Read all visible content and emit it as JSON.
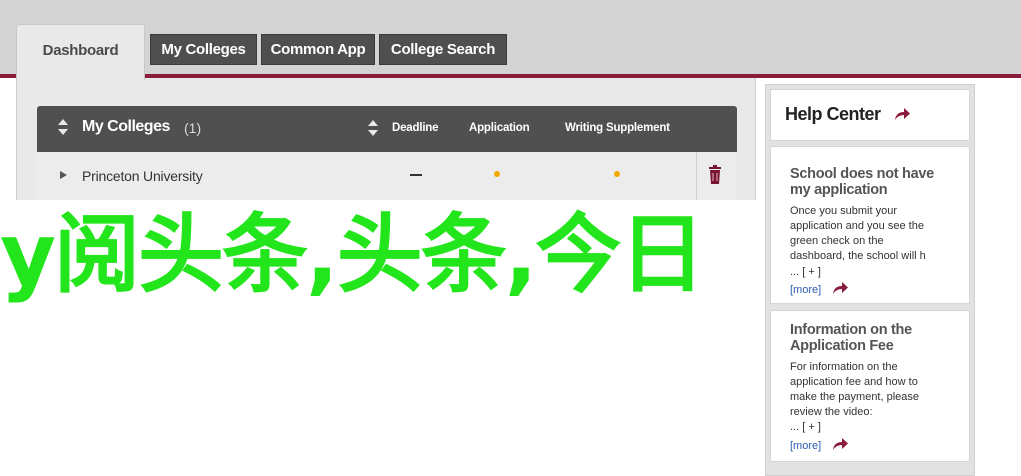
{
  "tabs": [
    {
      "label": "Dashboard",
      "active": true
    },
    {
      "label": "My Colleges",
      "active": false
    },
    {
      "label": "Common App",
      "active": false
    },
    {
      "label": "College Search",
      "active": false
    }
  ],
  "colors": {
    "accent": "#8a1d3b",
    "tab_dark": "#4f4f4f",
    "status_dot": "#f3a800",
    "overlay_text": "#22e61b",
    "link": "#2a5db0"
  },
  "colleges_table": {
    "title": "My Colleges",
    "count": "(1)",
    "columns": [
      "Deadline",
      "Application",
      "Writing Supplement"
    ],
    "rows": [
      {
        "name": "Princeton University",
        "deadline": "—",
        "application_status": "dot-orange",
        "writing_supplement_status": "dot-orange"
      }
    ]
  },
  "help_center": {
    "title": "Help Center",
    "cards": [
      {
        "title_lines": [
          "School does not have",
          "my application"
        ],
        "body_lines": [
          "Once you submit your",
          "application and you see the",
          "green check on the",
          "dashboard, the school will h"
        ],
        "plus": "... [ + ]",
        "more": "[more]"
      },
      {
        "title_lines": [
          "Information on the",
          "Application Fee"
        ],
        "body_lines": [
          "For information on the",
          "application fee and how to",
          "make the payment, please",
          "review the video:"
        ],
        "plus": "... [ + ]",
        "more": "[more]"
      }
    ]
  },
  "icons": {
    "sort": "sort-updown-icon",
    "expand": "triangle-right-icon",
    "delete": "trash-icon",
    "go": "curved-arrow-icon"
  },
  "overlay_text": "y阅头条,头条,今日"
}
